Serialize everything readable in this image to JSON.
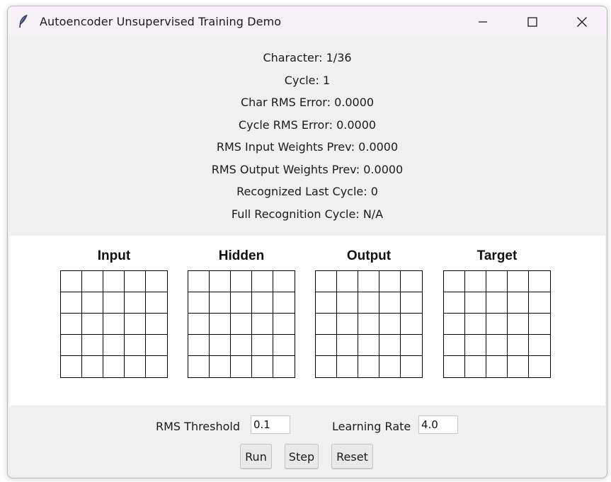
{
  "window": {
    "title": "Autoencoder Unsupervised Training Demo",
    "icon": "feather-icon",
    "controls": [
      "minimize-icon",
      "maximize-icon",
      "close-icon"
    ]
  },
  "stats": [
    "Character: 1/36",
    "Cycle: 1",
    "Char RMS Error: 0.0000",
    "Cycle RMS Error: 0.0000",
    "RMS Input Weights Prev: 0.0000",
    "RMS Output Weights Prev: 0.0000",
    "Recognized Last Cycle: 0",
    "Full Recognition Cycle: N/A"
  ],
  "grids": [
    {
      "label": "Input",
      "rows": 5,
      "cols": 5
    },
    {
      "label": "Hidden",
      "rows": 5,
      "cols": 5
    },
    {
      "label": "Output",
      "rows": 5,
      "cols": 5
    },
    {
      "label": "Target",
      "rows": 5,
      "cols": 5
    }
  ],
  "controls": {
    "rms_threshold_label": "RMS Threshold",
    "rms_threshold_value": "0.1",
    "learning_rate_label": "Learning Rate",
    "learning_rate_value": "4.0"
  },
  "buttons": {
    "run": "Run",
    "step": "Step",
    "reset": "Reset"
  }
}
